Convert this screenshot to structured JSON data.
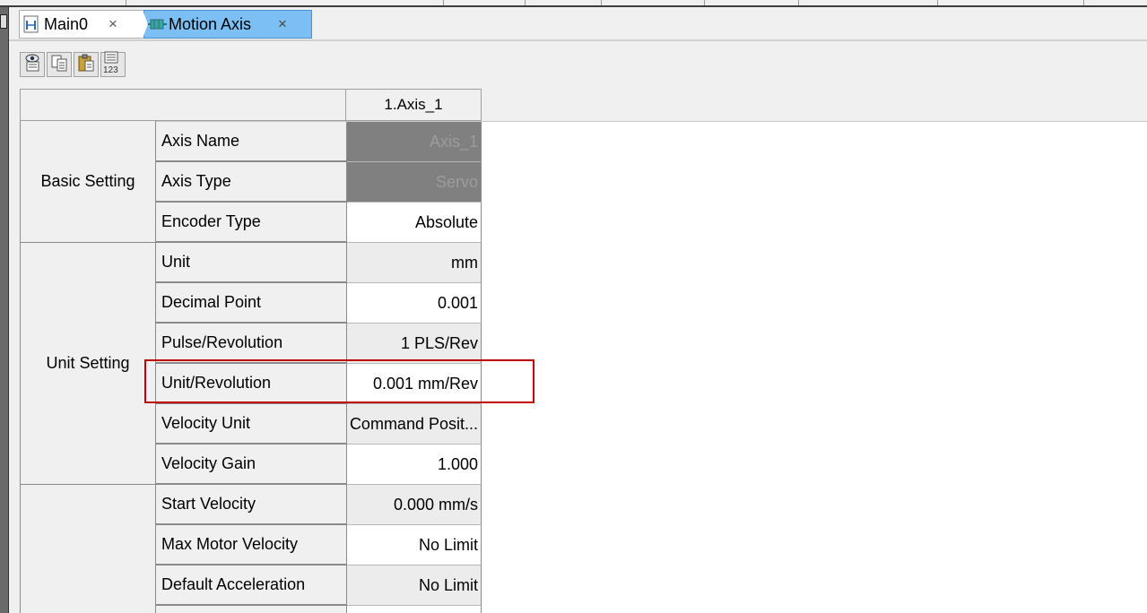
{
  "tabs": [
    {
      "label": "Main0",
      "icon": "ladder-program-icon",
      "close": "×"
    },
    {
      "label": "Motion Axis",
      "icon": "motion-axis-icon",
      "close": "×"
    }
  ],
  "toolbar": {
    "buttons": [
      "view-icon",
      "copy-icon",
      "paste-icon",
      "numbering-icon"
    ],
    "numbering_text": "123"
  },
  "grid": {
    "column_header": "1.Axis_1",
    "groups": [
      {
        "label": "Basic Setting"
      },
      {
        "label": "Unit Setting"
      },
      {
        "label": ""
      }
    ],
    "rows": [
      {
        "name": "Axis Name",
        "value": "Axis_1"
      },
      {
        "name": "Axis Type",
        "value": "Servo"
      },
      {
        "name": "Encoder Type",
        "value": "Absolute"
      },
      {
        "name": "Unit",
        "value": "mm"
      },
      {
        "name": "Decimal Point",
        "value": "0.001"
      },
      {
        "name": "Pulse/Revolution",
        "value": "1 PLS/Rev"
      },
      {
        "name": "Unit/Revolution",
        "value": "0.001 mm/Rev"
      },
      {
        "name": "Velocity Unit",
        "value": "Command Posit..."
      },
      {
        "name": "Velocity Gain",
        "value": "1.000"
      },
      {
        "name": "Start Velocity",
        "value": "0.000 mm/s"
      },
      {
        "name": "Max Motor Velocity",
        "value": "No Limit"
      },
      {
        "name": "Default Acceleration",
        "value": "No Limit"
      }
    ]
  },
  "colors": {
    "active_tab": "#7bbff5",
    "highlight": "#c00000",
    "disabled_cell": "#808080"
  }
}
